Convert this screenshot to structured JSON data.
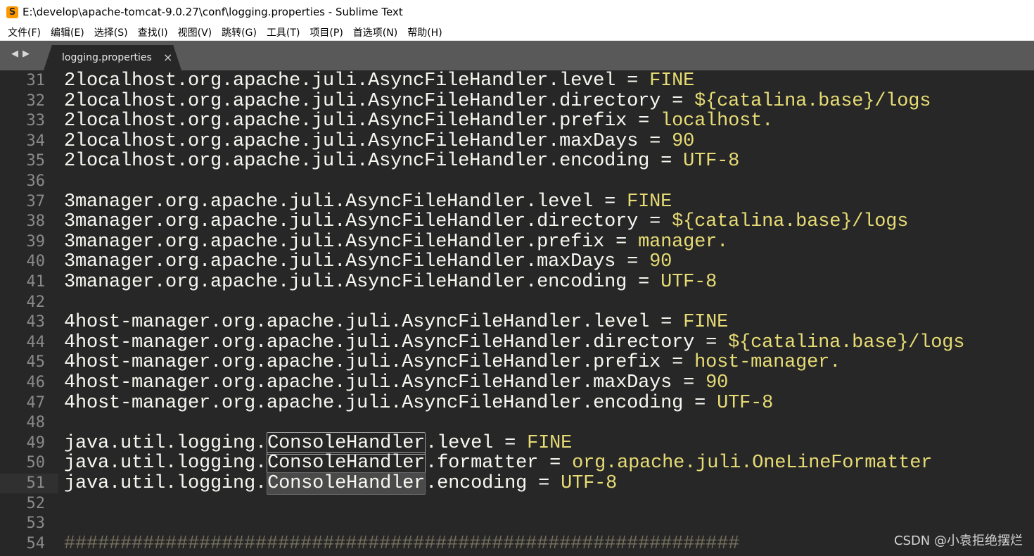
{
  "window": {
    "title": "E:\\develop\\apache-tomcat-9.0.27\\conf\\logging.properties - Sublime Text",
    "app_icon_glyph": "S"
  },
  "menu": [
    "文件(F)",
    "编辑(E)",
    "选择(S)",
    "查找(I)",
    "视图(V)",
    "跳转(G)",
    "工具(T)",
    "项目(P)",
    "首选项(N)",
    "帮助(H)"
  ],
  "tabs": [
    {
      "label": "logging.properties",
      "close_glyph": "×"
    }
  ],
  "nav": {
    "back_glyph": "◀",
    "forward_glyph": "▶"
  },
  "editor": {
    "lines": [
      {
        "num": "31",
        "key": "2localhost.org.apache.juli.AsyncFileHandler.level",
        "sep": " = ",
        "value": "FINE"
      },
      {
        "num": "32",
        "key": "2localhost.org.apache.juli.AsyncFileHandler.directory",
        "sep": " = ",
        "value": "${catalina.base}/logs"
      },
      {
        "num": "33",
        "key": "2localhost.org.apache.juli.AsyncFileHandler.prefix",
        "sep": " = ",
        "value": "localhost."
      },
      {
        "num": "34",
        "key": "2localhost.org.apache.juli.AsyncFileHandler.maxDays",
        "sep": " = ",
        "value": "90"
      },
      {
        "num": "35",
        "key": "2localhost.org.apache.juli.AsyncFileHandler.encoding",
        "sep": " = ",
        "value": "UTF-8"
      },
      {
        "num": "36",
        "key": "",
        "sep": "",
        "value": ""
      },
      {
        "num": "37",
        "key": "3manager.org.apache.juli.AsyncFileHandler.level",
        "sep": " = ",
        "value": "FINE"
      },
      {
        "num": "38",
        "key": "3manager.org.apache.juli.AsyncFileHandler.directory",
        "sep": " = ",
        "value": "${catalina.base}/logs"
      },
      {
        "num": "39",
        "key": "3manager.org.apache.juli.AsyncFileHandler.prefix",
        "sep": " = ",
        "value": "manager."
      },
      {
        "num": "40",
        "key": "3manager.org.apache.juli.AsyncFileHandler.maxDays",
        "sep": " = ",
        "value": "90"
      },
      {
        "num": "41",
        "key": "3manager.org.apache.juli.AsyncFileHandler.encoding",
        "sep": " = ",
        "value": "UTF-8"
      },
      {
        "num": "42",
        "key": "",
        "sep": "",
        "value": ""
      },
      {
        "num": "43",
        "key": "4host-manager.org.apache.juli.AsyncFileHandler.level",
        "sep": " = ",
        "value": "FINE"
      },
      {
        "num": "44",
        "key": "4host-manager.org.apache.juli.AsyncFileHandler.directory",
        "sep": " = ",
        "value": "${catalina.base}/logs"
      },
      {
        "num": "45",
        "key": "4host-manager.org.apache.juli.AsyncFileHandler.prefix",
        "sep": " = ",
        "value": "host-manager."
      },
      {
        "num": "46",
        "key": "4host-manager.org.apache.juli.AsyncFileHandler.maxDays",
        "sep": " = ",
        "value": "90"
      },
      {
        "num": "47",
        "key": "4host-manager.org.apache.juli.AsyncFileHandler.encoding",
        "sep": " = ",
        "value": "UTF-8"
      },
      {
        "num": "48",
        "key": "",
        "sep": "",
        "value": ""
      },
      {
        "num": "49",
        "prefix": "java.util.logging.",
        "match": "ConsoleHandler",
        "suffix": ".level",
        "sep": " = ",
        "value": "FINE",
        "match_style": "outline"
      },
      {
        "num": "50",
        "prefix": "java.util.logging.",
        "match": "ConsoleHandler",
        "suffix": ".formatter",
        "sep": " = ",
        "value": "org.apache.juli.OneLineFormatter",
        "match_style": "outline"
      },
      {
        "num": "51",
        "prefix": "java.util.logging.",
        "match": "ConsoleHandler",
        "suffix": ".encoding",
        "sep": " = ",
        "value": "UTF-8",
        "match_style": "selected",
        "current": true
      },
      {
        "num": "52",
        "key": "",
        "sep": "",
        "value": ""
      },
      {
        "num": "53",
        "key": "",
        "sep": "",
        "value": ""
      },
      {
        "num": "54",
        "comment": "############################################################"
      }
    ]
  },
  "watermark": "CSDN @小袁拒绝摆烂"
}
